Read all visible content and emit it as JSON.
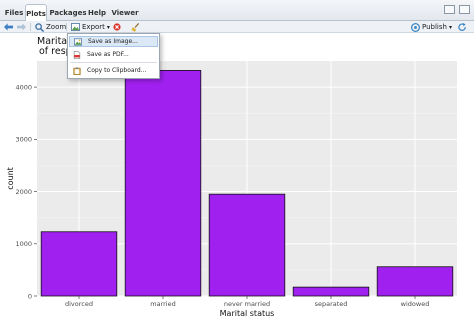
{
  "tabs": [
    {
      "label": "Files"
    },
    {
      "label": "Plots"
    },
    {
      "label": "Packages"
    },
    {
      "label": "Help"
    },
    {
      "label": "Viewer"
    }
  ],
  "toolbar": {
    "zoom_label": "Zoom",
    "export_label": "Export",
    "export_arrow": "▾",
    "publish_label": "Publish",
    "publish_arrow": "▾"
  },
  "export_menu": {
    "items": [
      {
        "label": "Save as Image...",
        "icon": "image-icon",
        "hovered": true
      },
      {
        "label": "Save as PDF...",
        "icon": "pdf-icon",
        "hovered": false
      },
      {
        "label": "Copy to Clipboard...",
        "icon": "clipboard-icon",
        "hovered": false
      }
    ]
  },
  "chart_data": {
    "type": "bar",
    "title_lines": [
      "Marital s",
      "of respo"
    ],
    "xlabel": "Marital status",
    "ylabel": "count",
    "categories": [
      "divorced",
      "married",
      "never married",
      "separated",
      "widowed"
    ],
    "values": [
      1230,
      4320,
      1950,
      170,
      560
    ],
    "ylim": [
      0,
      4500
    ],
    "yticks": [
      0,
      1000,
      2000,
      3000,
      4000
    ],
    "grid": true,
    "bar_color": "#a020f0",
    "panel_color": "#ebebeb"
  }
}
